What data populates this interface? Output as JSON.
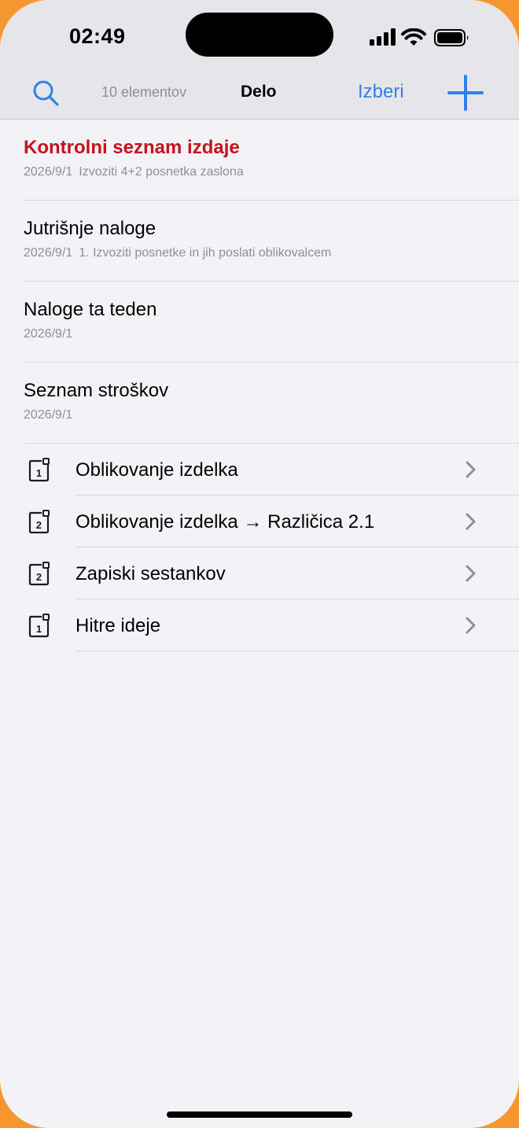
{
  "status_bar": {
    "time": "02:49"
  },
  "header": {
    "item_count": "10 elementov",
    "title": "Delo",
    "select_label": "Izberi"
  },
  "colors": {
    "accent": "#2f80ed",
    "alert": "#c4131a"
  },
  "notes": [
    {
      "title": "Kontrolni seznam izdaje",
      "date": "2026/9/1",
      "snippet": "Izvoziti 4+2 posnetka zaslona",
      "flagged": true
    },
    {
      "title": "Jutrišnje naloge",
      "date": "2026/9/1",
      "snippet": "1. Izvoziti posnetke in jih poslati oblikovalcem"
    },
    {
      "title": "Naloge ta teden",
      "date": "2026/9/1",
      "snippet": ""
    },
    {
      "title": "Seznam stroškov",
      "date": "2026/9/1",
      "snippet": ""
    }
  ],
  "folders": [
    {
      "label": "Oblikovanje izdelka",
      "badge": "1",
      "icon": "folder-badge-icon"
    },
    {
      "label": "Oblikovanje izdelka → Različica 2.1",
      "badge": "2",
      "icon": "folder-badge-icon"
    },
    {
      "label": "Zapiski sestankov",
      "badge": "2",
      "icon": "folder-badge-icon"
    },
    {
      "label": "Hitre ideje",
      "badge": "1",
      "icon": "folder-badge-icon"
    }
  ]
}
